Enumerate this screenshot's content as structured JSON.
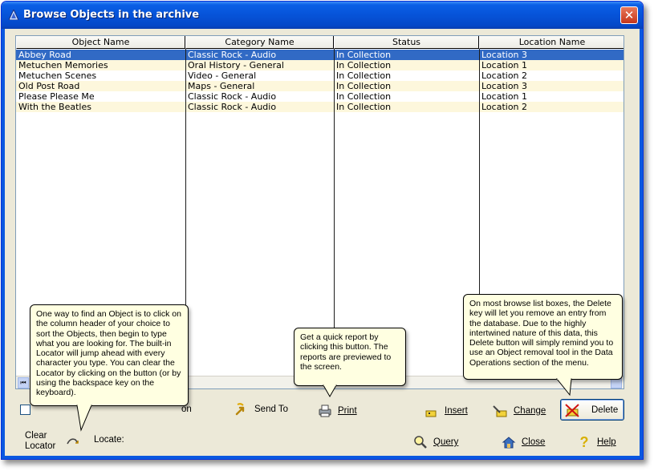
{
  "window": {
    "title": "Browse Objects in the archive",
    "close_glyph": "✕"
  },
  "grid": {
    "columns": [
      "Object Name",
      "Category Name",
      "Status",
      "Location Name"
    ],
    "rows": [
      [
        "Abbey Road",
        "Classic Rock - Audio",
        "In Collection",
        "Location 3"
      ],
      [
        "Metuchen Memories",
        "Oral History - General",
        "In Collection",
        "Location 1"
      ],
      [
        "Metuchen Scenes",
        "Video - General",
        "In Collection",
        "Location 2"
      ],
      [
        "Old Post Road",
        "Maps - General",
        "In Collection",
        "Location 3"
      ],
      [
        "Please Please Me",
        "Classic Rock - Audio",
        "In Collection",
        "Location 1"
      ],
      [
        "With the Beatles",
        "Classic Rock - Audio",
        "In Collection",
        "Location 2"
      ]
    ],
    "selected_row": 0,
    "scroll_first_glyph": "⏮"
  },
  "tooltips": {
    "locator": "One way to find an Object is to click on the column header of your choice to sort the Objects, then begin to type what you are looking for. The built-in Locator will jump ahead with every character you type. You can clear the Locator by clicking on the button (or by using the backspace key on the keyboard).",
    "print": "Get a quick report by clicking this button. The reports are previewed to the screen.",
    "delete": "On most browse list boxes, the Delete key will let you remove an entry from the database. Due to the highly intertwined nature of this data, this Delete button will simply remind you to use an Object removal tool in the Data Operations section of the menu."
  },
  "buttons": {
    "send_to": "Send To",
    "print": "Print",
    "insert": "Insert",
    "change": "Change",
    "delete": "Delete",
    "query": "Query",
    "close": "Close",
    "help": "Help",
    "clear_locator_line1": "Clear",
    "clear_locator_line2": "Locator",
    "partial_label": "on"
  },
  "locate": {
    "label": "Locate:"
  },
  "colors": {
    "selection": "#316ac5",
    "row_alt": "#fdf7dc",
    "tooltip": "#ffffe1",
    "titlebar": "#0653d8"
  },
  "icons": [
    "window-icon",
    "close-icon",
    "send-to-icon",
    "print-icon",
    "insert-icon",
    "change-icon",
    "delete-icon",
    "query-icon",
    "close-door-icon",
    "help-icon",
    "clear-locator-icon"
  ]
}
